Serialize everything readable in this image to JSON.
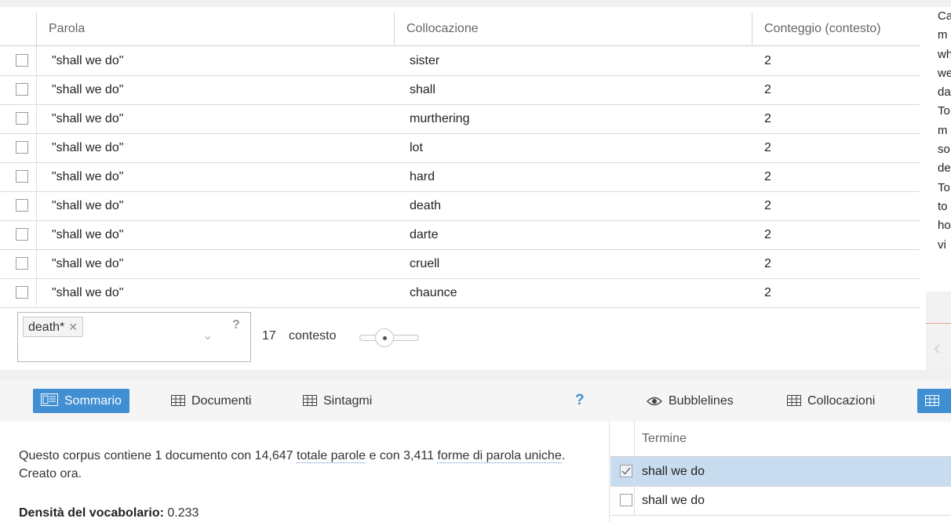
{
  "grid": {
    "headers": {
      "word": "Parola",
      "collocate": "Collocazione",
      "count": "Conteggio (contesto)"
    },
    "rows": [
      {
        "word": "\"shall we do\"",
        "collocate": "sister",
        "count": "2"
      },
      {
        "word": "\"shall we do\"",
        "collocate": "shall",
        "count": "2"
      },
      {
        "word": "\"shall we do\"",
        "collocate": "murthering",
        "count": "2"
      },
      {
        "word": "\"shall we do\"",
        "collocate": "lot",
        "count": "2"
      },
      {
        "word": "\"shall we do\"",
        "collocate": "hard",
        "count": "2"
      },
      {
        "word": "\"shall we do\"",
        "collocate": "death",
        "count": "2"
      },
      {
        "word": "\"shall we do\"",
        "collocate": "darte",
        "count": "2"
      },
      {
        "word": "\"shall we do\"",
        "collocate": "cruell",
        "count": "2"
      },
      {
        "word": "\"shall we do\"",
        "collocate": "chaunce",
        "count": "2"
      }
    ]
  },
  "filter": {
    "tag": "death*",
    "remove_symbol": "✕",
    "chevron": "⌄",
    "help": "?",
    "context_value": "17",
    "context_label": "contesto"
  },
  "side_panel": {
    "lines": [
      "Ca",
      "m",
      "wh",
      "we",
      "da",
      "To",
      "m",
      "so",
      "de",
      "To",
      "to",
      "ho",
      "vi"
    ],
    "nav_prev": "‹"
  },
  "bottom_left": {
    "tabs": {
      "summary": "Sommario",
      "documents": "Documenti",
      "phrases": "Sintagmi"
    },
    "help": "?",
    "summary": {
      "prefix": "Questo corpus contiene 1 documento con 14,647 ",
      "total_words": "totale parole",
      "middle": " e con 3,411 ",
      "unique_forms": "forme di parola uniche",
      "suffix": ". Creato ora."
    },
    "density_label": "Densità del vocabolario:",
    "density_value": "0.233"
  },
  "bottom_right": {
    "tabs": {
      "bubblelines": "Bubblelines",
      "collocates": "Collocazioni"
    },
    "terms_header": "Termine",
    "terms": [
      {
        "label": "shall we do",
        "checked": true
      },
      {
        "label": "shall we do",
        "checked": false
      }
    ]
  },
  "colors": {
    "accent": "#3f8fd2",
    "selected_row": "#c8dcf0"
  }
}
